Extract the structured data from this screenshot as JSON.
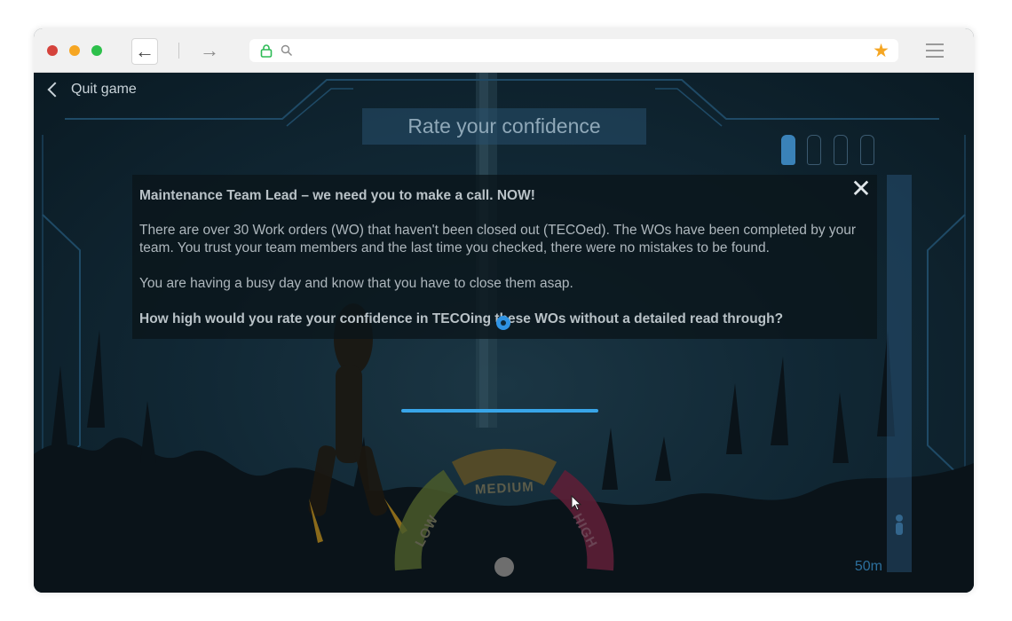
{
  "browser": {
    "traffic_lights": [
      "#d5433c",
      "#f6a623",
      "#2dc04b"
    ],
    "back_glyph": "←",
    "forward_glyph": "→",
    "lock_icon": "lock-icon",
    "search_icon": "search-icon",
    "bookmark_glyph": "★",
    "bookmark_color": "#f5a623"
  },
  "game": {
    "quit_label": "Quit game",
    "title": "Rate your confidence",
    "modal": {
      "close_glyph": "✕",
      "heading": "Maintenance Team Lead – we need you to make a call. NOW!",
      "paragraph1": "There are over 30 Work orders (WO) that haven't been closed out (TECOed). The WOs have been completed by your team. You trust your team members and the last time you checked, there were no mistakes to be found.",
      "paragraph2": "You are having a busy day and know that you have to close them asap.",
      "question": "How high would you rate your confidence in TECOing these WOs without a detailed read through?"
    },
    "gauge": {
      "low": "LOW",
      "medium": "MEDIUM",
      "high": "HIGH",
      "colors": {
        "low": "#4a5a2a",
        "medium": "#5e4f24",
        "high": "#5c1f36"
      }
    },
    "depth_label": "50m",
    "air_tanks": {
      "total": 4,
      "filled": 1
    }
  }
}
